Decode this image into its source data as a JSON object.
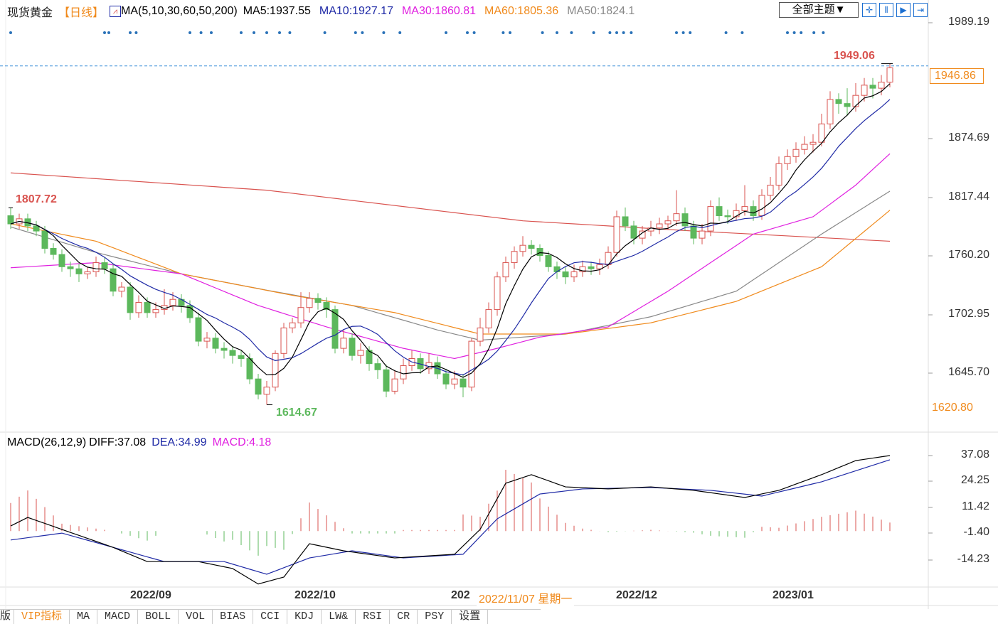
{
  "header": {
    "symbol": "现货黄金",
    "period": "【日线】",
    "ma_params": "MA(5,10,30,60,50,200)",
    "ma5": "MA5:1937.55",
    "ma10": "MA10:1927.17",
    "ma30": "MA30:1860.81",
    "ma60": "MA60:1805.36",
    "ma50": "MA50:1824.1",
    "theme_select": "全部主题▼"
  },
  "toolbar": [
    "crosshair-icon",
    "zoom-range-icon",
    "play-icon",
    "export-icon"
  ],
  "colors": {
    "up": "#d9534f",
    "down": "#5cb85c",
    "ma5": "#000000",
    "ma10": "#1f2aa6",
    "ma30": "#e020e0",
    "ma60": "#f08a1c",
    "ma50": "#888888",
    "ma200": "#d9534f",
    "dea": "#1f2aa6",
    "diff": "#000000",
    "macd_label": "#e020e0",
    "accent": "#f08a1c"
  },
  "chart_data": [
    {
      "type": "candlestick",
      "price_axis": {
        "ticks": [
          "1989.19",
          "1874.69",
          "1817.44",
          "1760.20",
          "1702.95",
          "1645.70"
        ],
        "range": [
          1989.19,
          1645.7
        ]
      },
      "x_ticks": [
        {
          "label": "2022/09",
          "index": 17
        },
        {
          "label": "2022/10",
          "index": 36
        },
        {
          "label": "202",
          "index": 53
        },
        {
          "label": "2022/12",
          "index": 73
        },
        {
          "label": "2023/01",
          "index": 92
        }
      ],
      "crosshair_date": "2022/11/07 星期一",
      "current_price": "1946.86",
      "low_label": "1620.80",
      "annotations": {
        "high_start": "1807.72",
        "low": "1614.67",
        "high_end": "1949.06"
      },
      "candles": [
        [
          1800,
          1807.72,
          1787,
          1792
        ],
        [
          1792,
          1802,
          1787,
          1797
        ],
        [
          1797,
          1802,
          1785,
          1790
        ],
        [
          1790,
          1795,
          1780,
          1785
        ],
        [
          1785,
          1790,
          1763,
          1768
        ],
        [
          1768,
          1773,
          1757,
          1762
        ],
        [
          1762,
          1767,
          1745,
          1750
        ],
        [
          1750,
          1755,
          1740,
          1748
        ],
        [
          1748,
          1753,
          1735,
          1743
        ],
        [
          1743,
          1750,
          1738,
          1745
        ],
        [
          1745,
          1760,
          1740,
          1754
        ],
        [
          1754,
          1759,
          1743,
          1748
        ],
        [
          1748,
          1753,
          1721,
          1726
        ],
        [
          1726,
          1735,
          1720,
          1730
        ],
        [
          1730,
          1735,
          1698,
          1705
        ],
        [
          1705,
          1722,
          1700,
          1715
        ],
        [
          1715,
          1720,
          1700,
          1705
        ],
        [
          1705,
          1715,
          1700,
          1708
        ],
        [
          1708,
          1728,
          1703,
          1712
        ],
        [
          1712,
          1725,
          1707,
          1718
        ],
        [
          1718,
          1723,
          1705,
          1712
        ],
        [
          1712,
          1717,
          1695,
          1700
        ],
        [
          1700,
          1705,
          1672,
          1677
        ],
        [
          1677,
          1686,
          1670,
          1680
        ],
        [
          1680,
          1685,
          1665,
          1670
        ],
        [
          1670,
          1676,
          1660,
          1668
        ],
        [
          1668,
          1672,
          1655,
          1663
        ],
        [
          1663,
          1668,
          1652,
          1660
        ],
        [
          1660,
          1665,
          1635,
          1640
        ],
        [
          1640,
          1645,
          1620,
          1625
        ],
        [
          1625,
          1638,
          1614.67,
          1632
        ],
        [
          1632,
          1668,
          1628,
          1665
        ],
        [
          1665,
          1695,
          1660,
          1690
        ],
        [
          1690,
          1700,
          1685,
          1695
        ],
        [
          1695,
          1725,
          1690,
          1710
        ],
        [
          1710,
          1725,
          1705,
          1719
        ],
        [
          1719,
          1724,
          1708,
          1715
        ],
        [
          1715,
          1720,
          1700,
          1708
        ],
        [
          1708,
          1712,
          1665,
          1670
        ],
        [
          1670,
          1688,
          1665,
          1680
        ],
        [
          1680,
          1685,
          1658,
          1663
        ],
        [
          1663,
          1675,
          1655,
          1668
        ],
        [
          1668,
          1672,
          1648,
          1655
        ],
        [
          1655,
          1660,
          1640,
          1649
        ],
        [
          1649,
          1654,
          1622,
          1628
        ],
        [
          1628,
          1648,
          1625,
          1640
        ],
        [
          1640,
          1660,
          1635,
          1653
        ],
        [
          1653,
          1668,
          1648,
          1660
        ],
        [
          1660,
          1665,
          1645,
          1650
        ],
        [
          1650,
          1665,
          1645,
          1656
        ],
        [
          1656,
          1662,
          1640,
          1645
        ],
        [
          1645,
          1650,
          1630,
          1635
        ],
        [
          1635,
          1648,
          1630,
          1640
        ],
        [
          1640,
          1645,
          1622,
          1632
        ],
        [
          1632,
          1680,
          1628,
          1677
        ],
        [
          1677,
          1700,
          1672,
          1690
        ],
        [
          1690,
          1715,
          1685,
          1708
        ],
        [
          1708,
          1745,
          1702,
          1740
        ],
        [
          1740,
          1760,
          1735,
          1754
        ],
        [
          1754,
          1770,
          1748,
          1765
        ],
        [
          1765,
          1780,
          1760,
          1771
        ],
        [
          1771,
          1776,
          1762,
          1768
        ],
        [
          1768,
          1772,
          1755,
          1761
        ],
        [
          1761,
          1765,
          1745,
          1750
        ],
        [
          1750,
          1755,
          1738,
          1745
        ],
        [
          1745,
          1750,
          1733,
          1740
        ],
        [
          1740,
          1752,
          1735,
          1745
        ],
        [
          1745,
          1756,
          1740,
          1750
        ],
        [
          1750,
          1755,
          1742,
          1748
        ],
        [
          1748,
          1758,
          1742,
          1752
        ],
        [
          1752,
          1770,
          1748,
          1764
        ],
        [
          1764,
          1805,
          1760,
          1799
        ],
        [
          1799,
          1808,
          1785,
          1790
        ],
        [
          1790,
          1795,
          1772,
          1778
        ],
        [
          1778,
          1790,
          1772,
          1785
        ],
        [
          1785,
          1795,
          1780,
          1788
        ],
        [
          1788,
          1798,
          1782,
          1792
        ],
        [
          1792,
          1800,
          1786,
          1795
        ],
        [
          1795,
          1825,
          1790,
          1802
        ],
        [
          1802,
          1808,
          1785,
          1790
        ],
        [
          1790,
          1795,
          1772,
          1778
        ],
        [
          1778,
          1792,
          1772,
          1785
        ],
        [
          1785,
          1815,
          1780,
          1809
        ],
        [
          1809,
          1818,
          1795,
          1800
        ],
        [
          1800,
          1806,
          1792,
          1799
        ],
        [
          1799,
          1812,
          1795,
          1805
        ],
        [
          1805,
          1830,
          1800,
          1809
        ],
        [
          1809,
          1815,
          1795,
          1800
        ],
        [
          1800,
          1826,
          1796,
          1820
        ],
        [
          1820,
          1838,
          1815,
          1830
        ],
        [
          1830,
          1858,
          1825,
          1851
        ],
        [
          1851,
          1865,
          1845,
          1858
        ],
        [
          1858,
          1872,
          1852,
          1865
        ],
        [
          1865,
          1878,
          1860,
          1870
        ],
        [
          1870,
          1880,
          1862,
          1872
        ],
        [
          1872,
          1900,
          1868,
          1890
        ],
        [
          1890,
          1922,
          1885,
          1914
        ],
        [
          1914,
          1920,
          1900,
          1910
        ],
        [
          1910,
          1925,
          1898,
          1907
        ],
        [
          1907,
          1930,
          1902,
          1918
        ],
        [
          1918,
          1935,
          1912,
          1928
        ],
        [
          1928,
          1935,
          1915,
          1925
        ],
        [
          1925,
          1938,
          1918,
          1931
        ],
        [
          1931,
          1949.06,
          1926,
          1945
        ]
      ],
      "long_ma": {
        "ma30": [
          [
            0,
            1749
          ],
          [
            10,
            1754
          ],
          [
            20,
            1743
          ],
          [
            29,
            1712
          ],
          [
            37,
            1691
          ],
          [
            46,
            1670
          ],
          [
            52,
            1660
          ],
          [
            57,
            1670
          ],
          [
            62,
            1681
          ],
          [
            70,
            1691
          ],
          [
            77,
            1726
          ],
          [
            82,
            1754
          ],
          [
            87,
            1782
          ],
          [
            94,
            1799
          ],
          [
            99,
            1830
          ],
          [
            103,
            1860.81
          ]
        ],
        "ma60": [
          [
            0,
            1792
          ],
          [
            10,
            1775
          ],
          [
            20,
            1743
          ],
          [
            33,
            1722
          ],
          [
            45,
            1705
          ],
          [
            55,
            1684
          ],
          [
            65,
            1684
          ],
          [
            75,
            1695
          ],
          [
            85,
            1716
          ],
          [
            95,
            1750
          ],
          [
            103,
            1805.36
          ]
        ],
        "ma50": [
          [
            0,
            1789
          ],
          [
            10,
            1764
          ],
          [
            20,
            1743
          ],
          [
            30,
            1727
          ],
          [
            40,
            1712
          ],
          [
            50,
            1688
          ],
          [
            55,
            1678
          ],
          [
            65,
            1684
          ],
          [
            75,
            1701
          ],
          [
            85,
            1726
          ],
          [
            95,
            1782
          ],
          [
            103,
            1824.1
          ]
        ],
        "ma200": [
          [
            0,
            1842
          ],
          [
            30,
            1825
          ],
          [
            60,
            1795
          ],
          [
            80,
            1785
          ],
          [
            103,
            1775
          ]
        ]
      },
      "signal_dots": [
        0,
        11,
        11.5,
        14,
        14.7,
        21,
        22.3,
        23.5,
        27,
        28.5,
        30,
        31.5,
        32.7,
        36.8,
        40.4,
        41.2,
        43.7,
        45.6,
        51,
        53.5,
        54.3,
        57.7,
        58.5,
        62.3,
        64,
        65.7,
        68.3,
        70.2,
        71,
        71.8,
        72.7,
        78,
        78.8,
        79.6,
        83.8,
        85.7,
        91,
        91.8,
        92.6,
        94.1,
        95.2
      ]
    },
    {
      "type": "macd",
      "title": "MACD(26,12,9)",
      "diff_label": "DIFF:37.08",
      "dea_label": "DEA:34.99",
      "macd_label": "MACD:4.18",
      "axis": {
        "ticks": [
          "37.08",
          "24.25",
          "11.42",
          "-1.40",
          "-14.23"
        ],
        "range": [
          37.08,
          -14.23
        ]
      },
      "diff": [
        [
          0,
          2.5
        ],
        [
          2,
          6.7
        ],
        [
          6,
          0.8
        ],
        [
          12,
          -8
        ],
        [
          16,
          -15
        ],
        [
          22,
          -15
        ],
        [
          26,
          -18.4
        ],
        [
          29,
          -26
        ],
        [
          32,
          -22.6
        ],
        [
          35,
          -6.2
        ],
        [
          39,
          -9.7
        ],
        [
          45,
          -13.2
        ],
        [
          52,
          -11.4
        ],
        [
          55,
          0.8
        ],
        [
          58,
          23.5
        ],
        [
          61,
          27.7
        ],
        [
          65,
          21.7
        ],
        [
          70,
          20.7
        ],
        [
          75,
          21.7
        ],
        [
          80,
          20
        ],
        [
          86,
          16.5
        ],
        [
          90,
          20
        ],
        [
          95,
          27.7
        ],
        [
          99,
          34.6
        ],
        [
          103,
          37.08
        ]
      ],
      "dea": [
        [
          0,
          -4.4
        ],
        [
          6,
          -1
        ],
        [
          12,
          -8
        ],
        [
          18,
          -15
        ],
        [
          25,
          -15
        ],
        [
          30,
          -21.2
        ],
        [
          35,
          -13.2
        ],
        [
          40,
          -9.7
        ],
        [
          46,
          -13.2
        ],
        [
          53,
          -11.4
        ],
        [
          57,
          6
        ],
        [
          62,
          18.2
        ],
        [
          67,
          20.7
        ],
        [
          75,
          21.4
        ],
        [
          82,
          20
        ],
        [
          88,
          17.2
        ],
        [
          95,
          24.2
        ],
        [
          103,
          34.99
        ]
      ]
    }
  ],
  "tabs": [
    "版",
    "VIP指标",
    "MA",
    "MACD",
    "BOLL",
    "VOL",
    "BIAS",
    "CCI",
    "KDJ",
    "LW&",
    "RSI",
    "CR",
    "PSY",
    "设置"
  ]
}
